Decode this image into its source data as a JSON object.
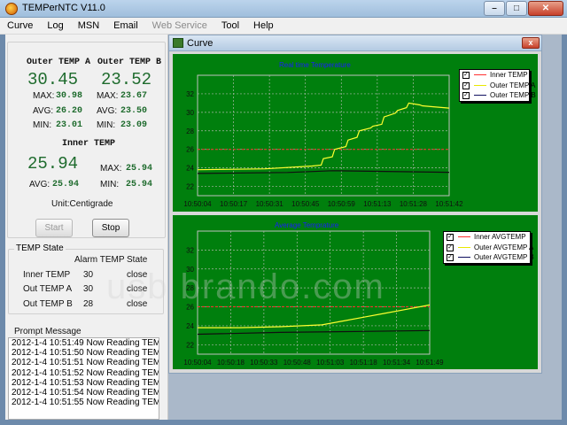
{
  "window": {
    "title": "TEMPerNTC V11.0",
    "min_label": "–",
    "max_label": "□",
    "close_label": "✕"
  },
  "menu": [
    {
      "label": "Curve",
      "disabled": false
    },
    {
      "label": "Log",
      "disabled": false
    },
    {
      "label": "MSN",
      "disabled": false
    },
    {
      "label": "Email",
      "disabled": false
    },
    {
      "label": "Web Service",
      "disabled": true
    },
    {
      "label": "Tool",
      "disabled": false
    },
    {
      "label": "Help",
      "disabled": false
    }
  ],
  "readings": {
    "outer_a": {
      "heading": "Outer TEMP A",
      "current": "30.45",
      "max_label": "MAX:",
      "max": "30.98",
      "avg_label": "AVG:",
      "avg": "26.20",
      "min_label": "MIN:",
      "min": "23.01"
    },
    "outer_b": {
      "heading": "Outer TEMP B",
      "current": "23.52",
      "max_label": "MAX:",
      "max": "23.67",
      "avg_label": "AVG:",
      "avg": "23.50",
      "min_label": "MIN:",
      "min": "23.09"
    },
    "inner": {
      "heading": "Inner TEMP",
      "current": "25.94",
      "max_label": "MAX:",
      "max": "25.94",
      "avg_label": "AVG:",
      "avg": "25.94",
      "min_label": "MIN:",
      "min": "25.94"
    },
    "unit": "Unit:Centigrade"
  },
  "buttons": {
    "start": "Start",
    "stop": "Stop"
  },
  "temp_state": {
    "title": "TEMP State",
    "headers": [
      "",
      "Alarm TEMP",
      "State"
    ],
    "rows": [
      {
        "name": "Inner TEMP",
        "alarm": "30",
        "state": "close"
      },
      {
        "name": "Out TEMP A",
        "alarm": "30",
        "state": "close"
      },
      {
        "name": "Out TEMP B",
        "alarm": "28",
        "state": "close"
      }
    ]
  },
  "prompt": {
    "title": "Prompt Message",
    "lines": [
      "2012-1-4 10:51:49 Now Reading TEMP",
      "2012-1-4 10:51:50 Now Reading TEMP",
      "2012-1-4 10:51:51 Now Reading TEMP",
      "2012-1-4 10:51:52 Now Reading TEMP",
      "2012-1-4 10:51:53 Now Reading TEMP",
      "2012-1-4 10:51:54 Now Reading TEMP",
      "2012-1-4 10:51:55 Now Reading TEMP"
    ]
  },
  "curve_window": {
    "title": "Curve",
    "close_label": "x"
  },
  "watermark": "usb brando.com",
  "colors": {
    "plot_bg": "#007f0d",
    "inner": "#ff3030",
    "outer_a": "#ffff30",
    "outer_b": "#101010",
    "grid": "#a8b8a8",
    "title": "#1a1aff"
  },
  "chart_data": [
    {
      "type": "line",
      "title": "Real time Temperature",
      "ylim": [
        21,
        34
      ],
      "yticks": [
        22,
        24,
        26,
        28,
        30,
        32
      ],
      "xticks": [
        "10:50:04",
        "10:50:17",
        "10:50:31",
        "10:50:45",
        "10:50:59",
        "10:51:13",
        "10:51:28",
        "10:51:42"
      ],
      "xlim": [
        0,
        112
      ],
      "legend_position": "top-right",
      "series": [
        {
          "name": "Inner TEMP",
          "color": "#ff3030",
          "dashed": true,
          "x": [
            0,
            112
          ],
          "y": [
            26,
            26
          ]
        },
        {
          "name": "Outer TEMP A",
          "color": "#ffff30",
          "dashed": false,
          "x": [
            0,
            30,
            51,
            55,
            56,
            60,
            61,
            66,
            67,
            71,
            72,
            77,
            78,
            82,
            83,
            88,
            89,
            93,
            94,
            99,
            100,
            105,
            112
          ],
          "y": [
            23.8,
            23.9,
            24.2,
            24.3,
            25.0,
            25.2,
            26.0,
            26.3,
            27.0,
            27.3,
            28.0,
            28.3,
            28.5,
            28.7,
            29.5,
            29.9,
            30.2,
            30.5,
            31.0,
            30.8,
            30.7,
            30.6,
            30.45
          ]
        },
        {
          "name": "Outer TEMP B",
          "color": "#101010",
          "dashed": false,
          "x": [
            0,
            40,
            60,
            112
          ],
          "y": [
            23.4,
            23.5,
            23.7,
            23.52
          ]
        }
      ]
    },
    {
      "type": "line",
      "title": "Average Temprature",
      "ylim": [
        21,
        34
      ],
      "yticks": [
        22,
        24,
        26,
        28,
        30,
        32
      ],
      "xticks": [
        "10:50:04",
        "10:50:18",
        "10:50:33",
        "10:50:48",
        "10:51:03",
        "10:51:18",
        "10:51:34",
        "10:51:49"
      ],
      "xlim": [
        0,
        112
      ],
      "legend_position": "top-right",
      "series": [
        {
          "name": "Inner AVGTEMP",
          "color": "#ff3030",
          "dashed": true,
          "x": [
            0,
            112
          ],
          "y": [
            26,
            26
          ]
        },
        {
          "name": "Outer AVGTEMP A",
          "color": "#ffff30",
          "dashed": false,
          "x": [
            0,
            20,
            40,
            60,
            70,
            80,
            90,
            100,
            112
          ],
          "y": [
            23.8,
            23.8,
            23.9,
            24.1,
            24.5,
            24.9,
            25.3,
            25.7,
            26.2
          ]
        },
        {
          "name": "Outer AVGTEMP B",
          "color": "#101010",
          "dashed": false,
          "x": [
            0,
            40,
            80,
            112
          ],
          "y": [
            23.1,
            23.3,
            23.4,
            23.5
          ]
        }
      ]
    }
  ]
}
